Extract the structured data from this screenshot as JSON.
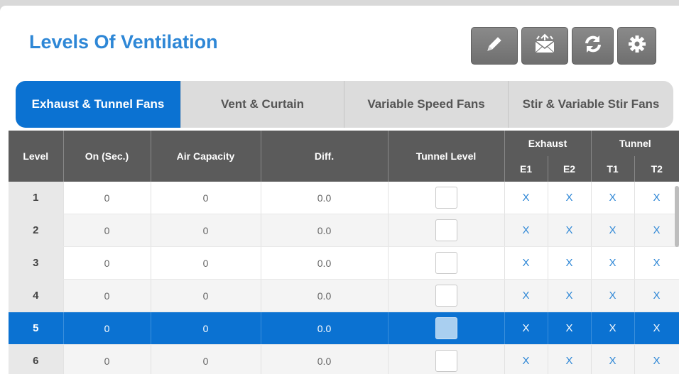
{
  "title": "Levels Of Ventilation",
  "toolbar": [
    {
      "name": "edit-button",
      "icon": "pencil-icon"
    },
    {
      "name": "send-button",
      "icon": "envelope-icon"
    },
    {
      "name": "refresh-button",
      "icon": "refresh-icon"
    },
    {
      "name": "settings-button",
      "icon": "gear-icon"
    }
  ],
  "tabs": [
    {
      "label": "Exhaust & Tunnel Fans",
      "active": true
    },
    {
      "label": "Vent & Curtain",
      "active": false
    },
    {
      "label": "Variable Speed Fans",
      "active": false
    },
    {
      "label": "Stir & Variable Stir Fans",
      "active": false
    }
  ],
  "table": {
    "headers": {
      "level": "Level",
      "on": "On (Sec.)",
      "air_capacity": "Air Capacity",
      "diff": "Diff.",
      "tunnel_level": "Tunnel Level",
      "exhaust": "Exhaust",
      "tunnel": "Tunnel",
      "e1": "E1",
      "e2": "E2",
      "t1": "T1",
      "t2": "T2"
    },
    "rows": [
      {
        "level": "1",
        "on": "0",
        "air": "0",
        "diff": "0.0",
        "e1": "X",
        "e2": "X",
        "t1": "X",
        "t2": "X",
        "selected": false
      },
      {
        "level": "2",
        "on": "0",
        "air": "0",
        "diff": "0.0",
        "e1": "X",
        "e2": "X",
        "t1": "X",
        "t2": "X",
        "selected": false
      },
      {
        "level": "3",
        "on": "0",
        "air": "0",
        "diff": "0.0",
        "e1": "X",
        "e2": "X",
        "t1": "X",
        "t2": "X",
        "selected": false
      },
      {
        "level": "4",
        "on": "0",
        "air": "0",
        "diff": "0.0",
        "e1": "X",
        "e2": "X",
        "t1": "X",
        "t2": "X",
        "selected": false
      },
      {
        "level": "5",
        "on": "0",
        "air": "0",
        "diff": "0.0",
        "e1": "X",
        "e2": "X",
        "t1": "X",
        "t2": "X",
        "selected": true
      },
      {
        "level": "6",
        "on": "0",
        "air": "0",
        "diff": "0.0",
        "e1": "X",
        "e2": "X",
        "t1": "X",
        "t2": "X",
        "selected": false
      }
    ]
  },
  "colors": {
    "accent": "#0b72d2",
    "title": "#2e87d6",
    "header_bg": "#5b5b5b"
  }
}
